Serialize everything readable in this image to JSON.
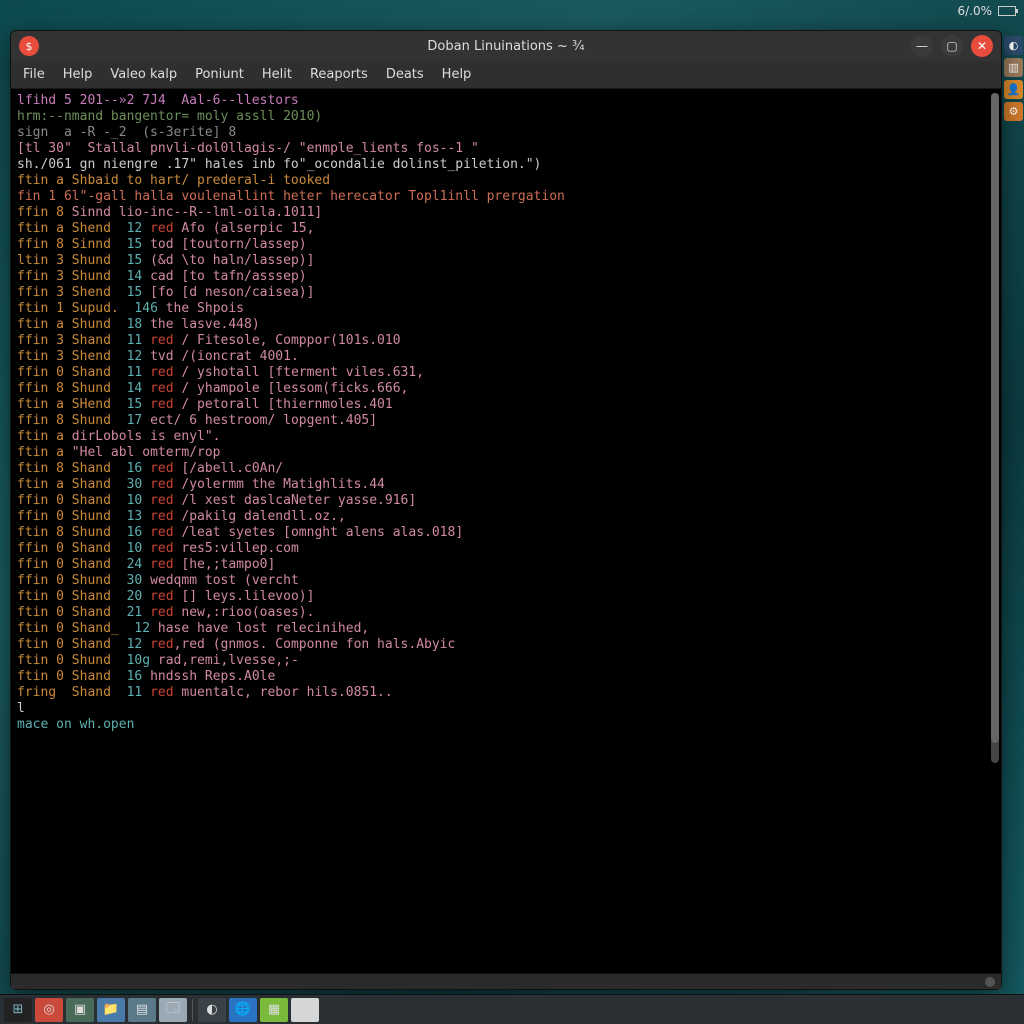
{
  "sysbar": {
    "battery_pct": "6/.0%"
  },
  "right_dock": [
    {
      "name": "moon-icon",
      "glyph": "◐",
      "bg": "#2a4a6a"
    },
    {
      "name": "files-icon",
      "glyph": "▥",
      "bg": "#9a7a5a"
    },
    {
      "name": "user-icon",
      "glyph": "👤",
      "bg": "#d98a2a"
    },
    {
      "name": "settings-icon",
      "glyph": "⚙",
      "bg": "#d07a2a"
    }
  ],
  "window": {
    "title": "Doban Linuinations ~ ¾",
    "menubar": [
      "File",
      "Help",
      "Valeo kalp",
      "Poniunt",
      "Helit",
      "Reaports",
      "Deats",
      "Help"
    ]
  },
  "terminal": {
    "header": [
      {
        "cls": "c-purple",
        "text": "lfihd 5 201--»2 7J4  Aal-6--llestors"
      },
      {
        "cls": "c-green",
        "text": "hrm:--nmand bangentor= moly assll 2010)"
      },
      {
        "cls": "c-grey",
        "text": "sign  a -R -_2  (s-3erite] 8"
      },
      {
        "cls": "c-pink",
        "text": "[tl 30\"  Stallal pnvli-dol0llagis-/ \"enmple_lients fos--1 \""
      },
      {
        "cls": "c-white",
        "text": "sh./061 gn niengre .17\" hales inb fo\"_ocondalie dolinst_piletion.\")"
      },
      {
        "cls": "c-orange",
        "text": "ftin a Shbaid to hart/ prederal-i tooked"
      },
      {
        "cls": "c-red",
        "text": "fin 1 6l\"-gall halla voulenallint heter herecator Topl1inll prergation"
      }
    ],
    "lines": [
      {
        "p": "ffin 8",
        "n": "",
        "t": "Sinnd lio-inc--R--lml-oila.1011]"
      },
      {
        "p": "ftin a",
        "n": "12",
        "t": "Shend   red Afo (alserpic 15,"
      },
      {
        "p": "ffin 8",
        "n": "15",
        "t": "Sinnd   tod [toutorn/lassep)"
      },
      {
        "p": "ltin 3",
        "n": "15",
        "t": "Shund   (&d \\to haln/lassep)]"
      },
      {
        "p": "ffin 3",
        "n": "14",
        "t": "Shund   cad [to tafn/asssep)"
      },
      {
        "p": "ffin 3",
        "n": "15",
        "t": "Shend   [fo [d neson/caisea)]"
      },
      {
        "p": "ftin 1",
        "n": "146",
        "t": "Supud. the Shpois"
      },
      {
        "p": "ftin a",
        "n": "18",
        "t": "Shund   the lasve.448)"
      },
      {
        "p": "ffin 3",
        "n": "11",
        "t": "Shand   red / Fitesole, Comppor(101s.010"
      },
      {
        "p": "ftin 3",
        "n": "12",
        "t": "Shend   tvd /(ioncrat 4001."
      },
      {
        "p": "ffin 0",
        "n": "11",
        "t": "Shand   red / yshotall [fterment viles.631,"
      },
      {
        "p": "ffin 8",
        "n": "14",
        "t": "Shund   red / yhampole [lessom(ficks.666,"
      },
      {
        "p": "ftin a",
        "n": "15",
        "t": "SHend   red / petorall [thiernmoles.401"
      },
      {
        "p": "ffin 8",
        "n": "17",
        "t": "Shund   ect/ 6 hestroom/ lopgent.405]"
      },
      {
        "p": "ftin a",
        "n": "",
        "t": "dirLobols is enyl\"."
      },
      {
        "p": "ftin a",
        "n": "",
        "t": "\"Hel abl omterm/rop"
      },
      {
        "p": "ftin 8",
        "n": "16",
        "t": "Shand   red [/abell.c0An/"
      },
      {
        "p": "ftin a",
        "n": "30",
        "t": "Shand   red /yolermm the Matighlits.44"
      },
      {
        "p": "ffin 0",
        "n": "10",
        "t": "Shand   red /l xest daslcaNeter yasse.916]"
      },
      {
        "p": "ffin 0",
        "n": "13",
        "t": "Shund   red /pakilg dalendll.oz.,"
      },
      {
        "p": "ftin 8",
        "n": "16",
        "t": "Shund   red /leat syetes [omnght alens alas.018]"
      },
      {
        "p": "ffin 0",
        "n": "10",
        "t": "Shand   red res5:villep.com"
      },
      {
        "p": "ffin 0",
        "n": "24",
        "t": "Shand   red [he,;tampo0]"
      },
      {
        "p": "ffin 0",
        "n": "30",
        "t": "Shund   wedqmm tost (vercht"
      },
      {
        "p": "ftin 0",
        "n": "20",
        "t": "Shand   red [] leys.lilevoo)]"
      },
      {
        "p": "ftin 0",
        "n": "21",
        "t": "Shand   red new,:rioo(oases)."
      },
      {
        "p": "ftin 0",
        "n": "12",
        "t": "Shand_  hase have lost relecinihed,"
      },
      {
        "p": "ftin 0",
        "n": "12",
        "t": "Shand   red,red (gnmos. Componne fon hals.Abyic"
      },
      {
        "p": "ftin 0",
        "n": "10g",
        "t": "Shund  rad,remi,lvesse,;-"
      },
      {
        "p": "ftin 0",
        "n": "16",
        "t": "Shand   hndssh Reps.A0le"
      },
      {
        "p": "fring ",
        "n": "11",
        "t": "Shand   red muentalc, rebor hils.0851.."
      }
    ],
    "tail": [
      {
        "cls": "c-white",
        "text": "l"
      },
      {
        "cls": "c-teal",
        "text": "mace on wh.open"
      }
    ]
  },
  "taskbar": [
    {
      "name": "start-menu",
      "glyph": "⊞",
      "bg": "#222"
    },
    {
      "name": "browser-icon",
      "glyph": "◎",
      "bg": "#c94a3a"
    },
    {
      "name": "app1-icon",
      "glyph": "▣",
      "bg": "#4a6a5a"
    },
    {
      "name": "files-tb-icon",
      "glyph": "📁",
      "bg": "#4a7aaa"
    },
    {
      "name": "app2-icon",
      "glyph": "▤",
      "bg": "#5a7a8a"
    },
    {
      "name": "app3-icon",
      "glyph": "🗔",
      "bg": "#9aa9b4"
    },
    {
      "name": "divider",
      "glyph": "",
      "bg": ""
    },
    {
      "name": "app4-icon",
      "glyph": "◐",
      "bg": "#3a4248"
    },
    {
      "name": "globe-icon",
      "glyph": "🌐",
      "bg": "#2a72c2"
    },
    {
      "name": "app5-icon",
      "glyph": "▦",
      "bg": "#7aba3a"
    },
    {
      "name": "music-icon",
      "glyph": "♪",
      "bg": "#d6d6d6"
    }
  ]
}
